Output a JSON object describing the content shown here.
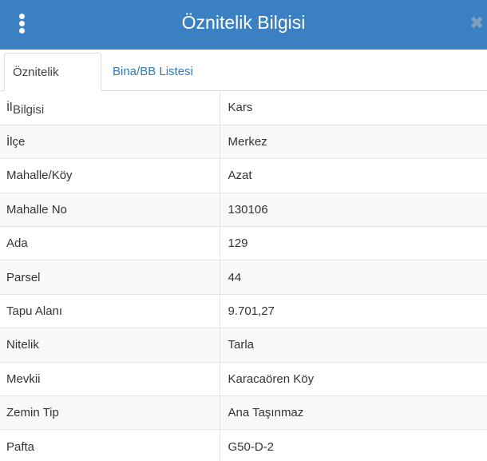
{
  "window": {
    "title": "Öznitelik Bilgisi",
    "menu_icon": "kebab-menu-icon",
    "close_icon": "close-icon",
    "close_glyph": "✖",
    "header_color": "#3a80c3"
  },
  "tabs": [
    {
      "label": "Öznitelik Bilgisi",
      "active": true
    },
    {
      "label": "Bina/BB Listesi",
      "active": false
    }
  ],
  "attributes": [
    {
      "key": "İl",
      "value": "Kars"
    },
    {
      "key": "İlçe",
      "value": "Merkez"
    },
    {
      "key": "Mahalle/Köy",
      "value": "Azat"
    },
    {
      "key": "Mahalle No",
      "value": "130106"
    },
    {
      "key": "Ada",
      "value": "129"
    },
    {
      "key": "Parsel",
      "value": "44"
    },
    {
      "key": "Tapu Alanı",
      "value": "9.701,27"
    },
    {
      "key": "Nitelik",
      "value": "Tarla"
    },
    {
      "key": "Mevkii",
      "value": "Karacaören Köy"
    },
    {
      "key": "Zemin Tip",
      "value": "Ana Taşınmaz"
    },
    {
      "key": "Pafta",
      "value": "G50-D-2"
    }
  ]
}
